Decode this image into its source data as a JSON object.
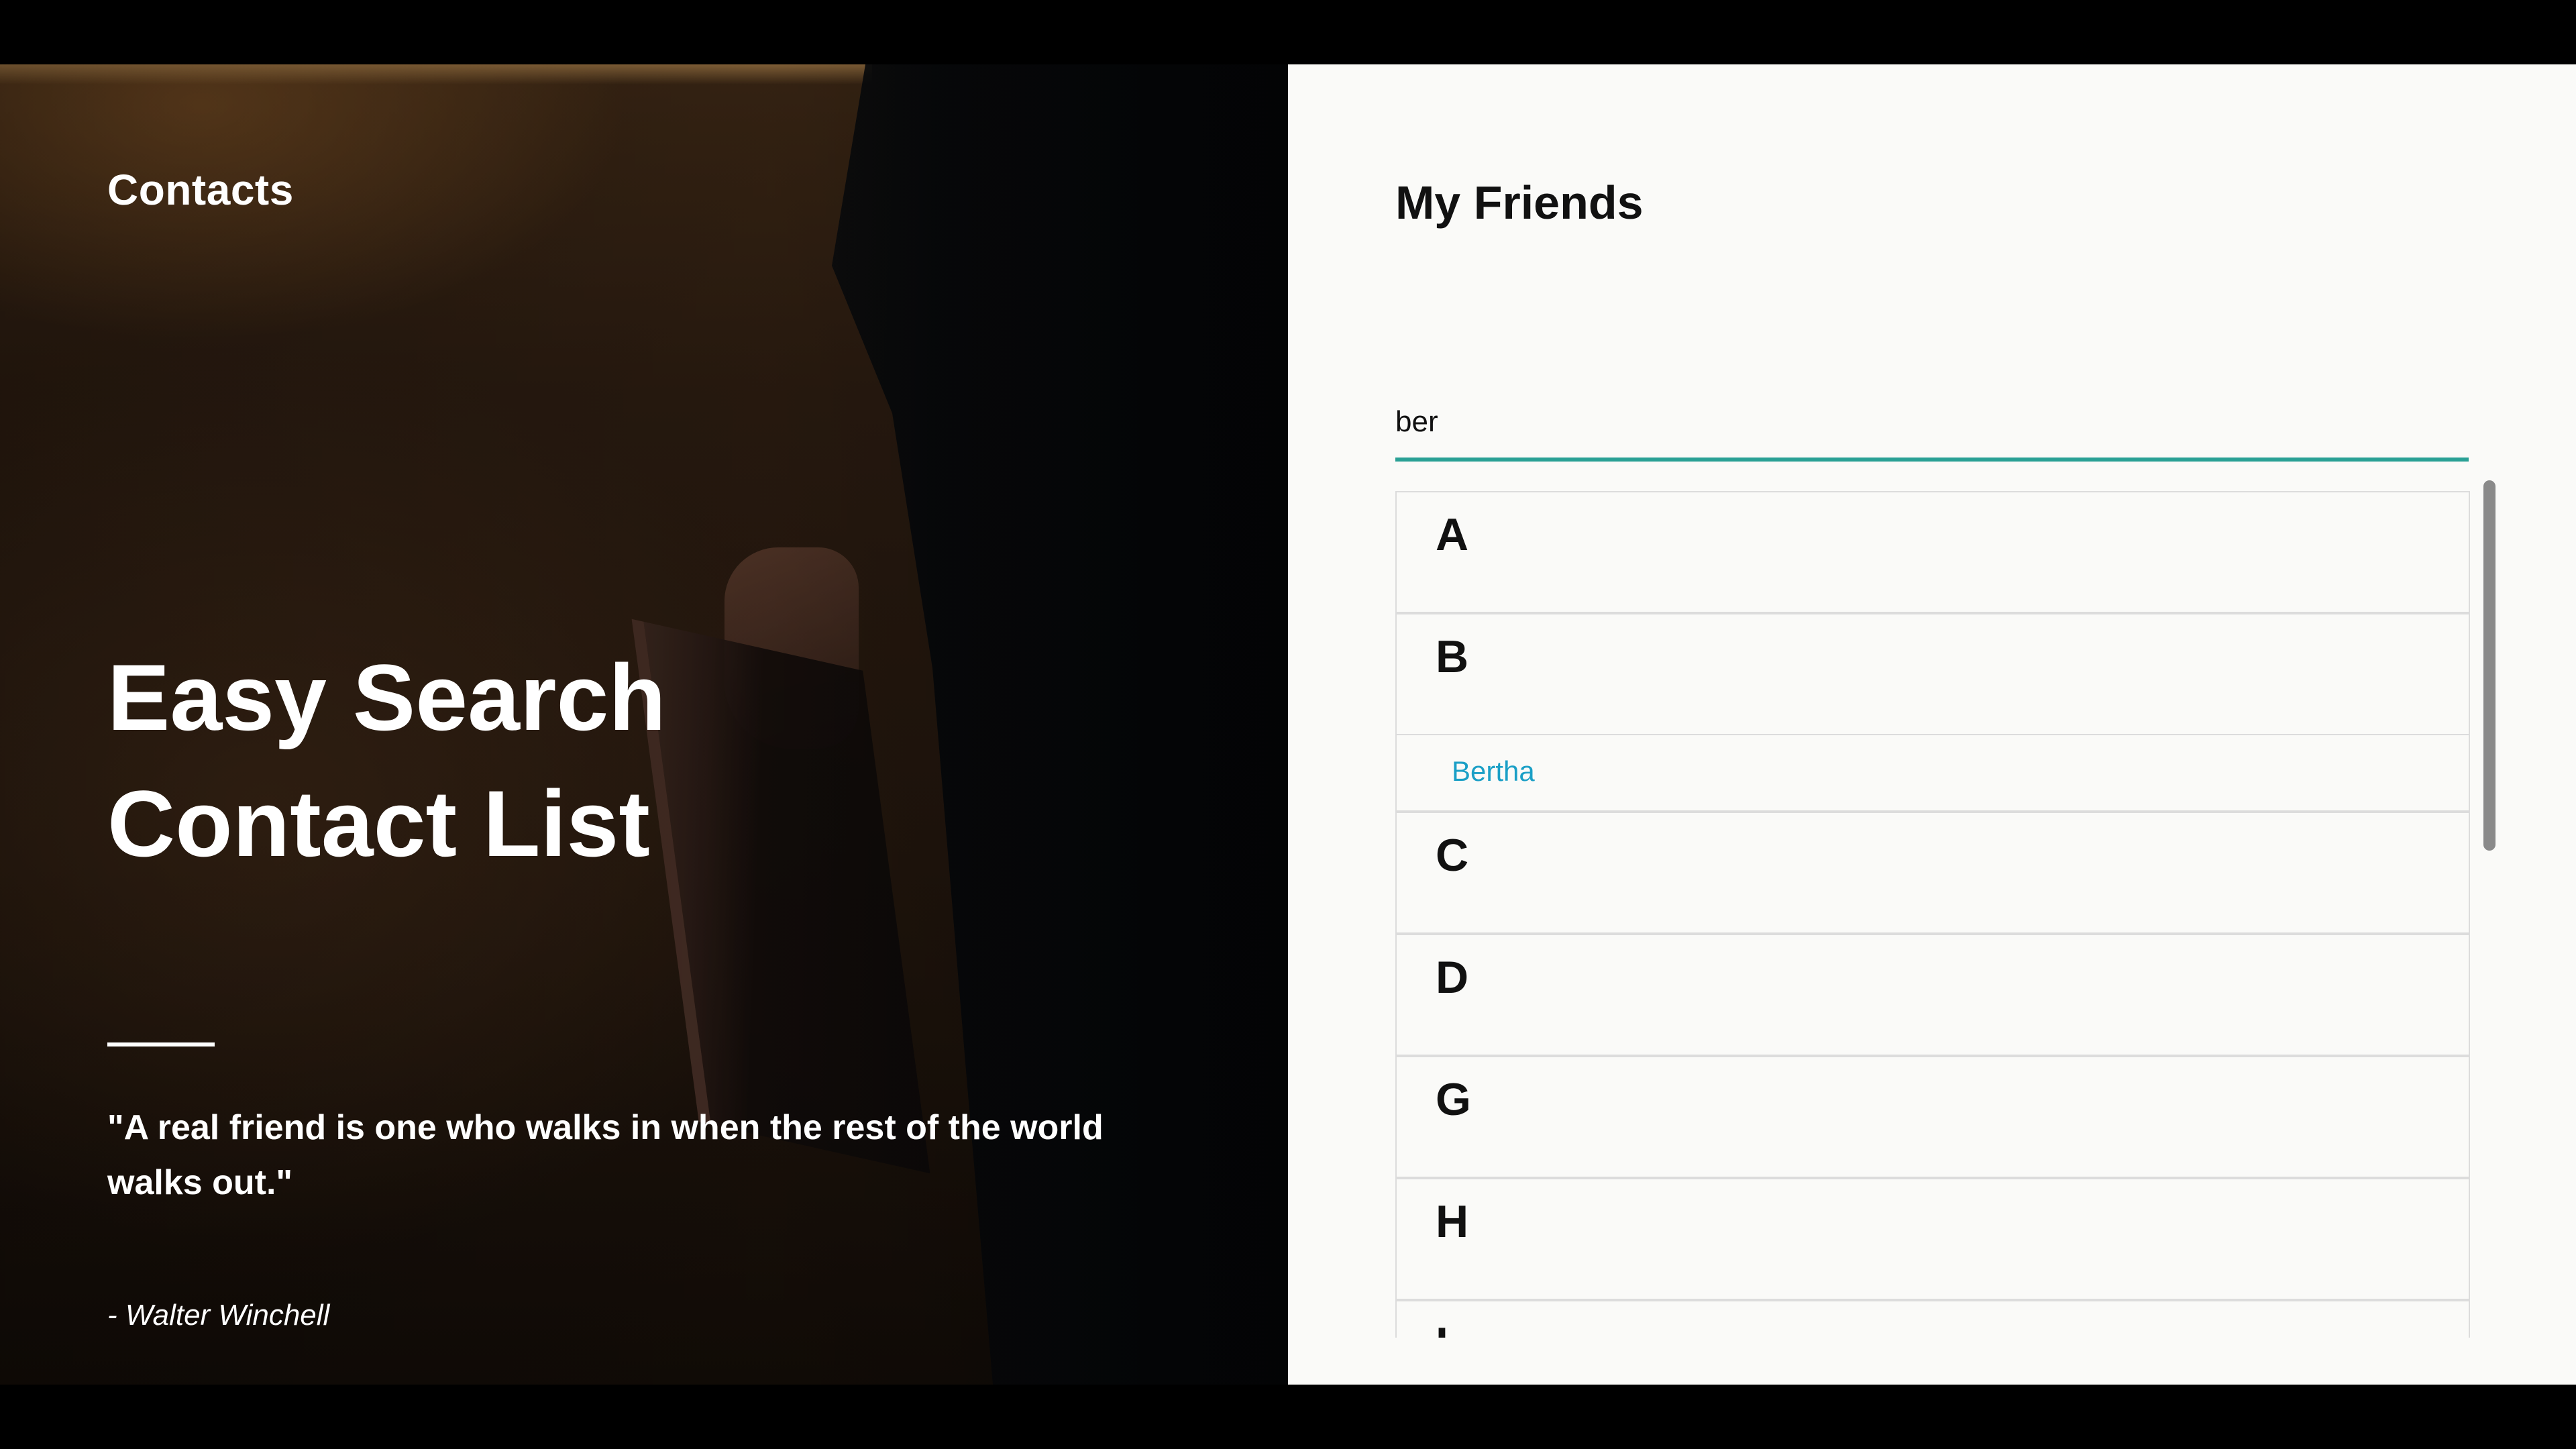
{
  "hero": {
    "brand": "Contacts",
    "headline_line1": "Easy Search",
    "headline_line2": "Contact List",
    "quote": "\"A real friend is one who walks in when the rest of the world walks out.\"",
    "author": "- Walter Winchell"
  },
  "panel": {
    "title": "My Friends",
    "search_value": "ber",
    "groups": [
      {
        "letter": "A",
        "contacts": []
      },
      {
        "letter": "B",
        "contacts": [
          "Bertha"
        ]
      },
      {
        "letter": "C",
        "contacts": []
      },
      {
        "letter": "D",
        "contacts": []
      },
      {
        "letter": "G",
        "contacts": []
      },
      {
        "letter": "H",
        "contacts": []
      },
      {
        "letter": "I",
        "contacts": []
      }
    ]
  },
  "colors": {
    "accent": "#29a095",
    "link": "#1a9fc6"
  }
}
